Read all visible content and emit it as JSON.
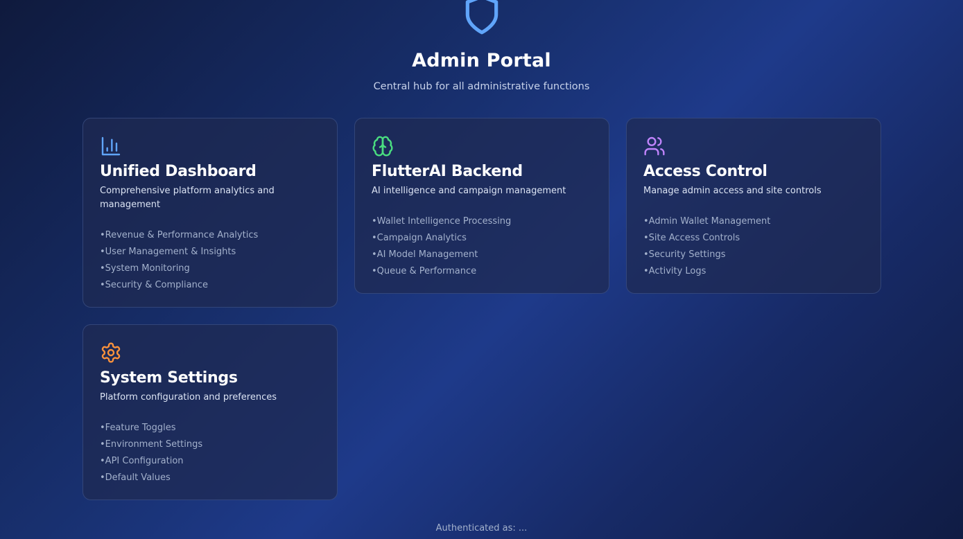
{
  "header": {
    "icon": "shield-icon",
    "title": "Admin Portal",
    "subtitle": "Central hub for all administrative functions"
  },
  "cards": [
    {
      "icon": "bar-chart-icon",
      "icon_color": "#60a5fa",
      "title": "Unified Dashboard",
      "description": "Comprehensive platform analytics and management",
      "features": [
        "Revenue & Performance Analytics",
        "User Management & Insights",
        "System Monitoring",
        "Security & Compliance"
      ]
    },
    {
      "icon": "brain-icon",
      "icon_color": "#4ade80",
      "title": "FlutterAI Backend",
      "description": "AI intelligence and campaign management",
      "features": [
        "Wallet Intelligence Processing",
        "Campaign Analytics",
        "AI Model Management",
        "Queue & Performance"
      ]
    },
    {
      "icon": "users-icon",
      "icon_color": "#c084fc",
      "title": "Access Control",
      "description": "Manage admin access and site controls",
      "features": [
        "Admin Wallet Management",
        "Site Access Controls",
        "Security Settings",
        "Activity Logs"
      ]
    },
    {
      "icon": "gear-icon",
      "icon_color": "#fb923c",
      "title": "System Settings",
      "description": "Platform configuration and preferences",
      "features": [
        "Feature Toggles",
        "Environment Settings",
        "API Configuration",
        "Default Values"
      ]
    }
  ],
  "footer": {
    "auth_text": "Authenticated as: ..."
  },
  "colors": {
    "accent_shield": "#60a5fa",
    "background": "#1e3a8a",
    "card_bg": "#1e2952"
  }
}
